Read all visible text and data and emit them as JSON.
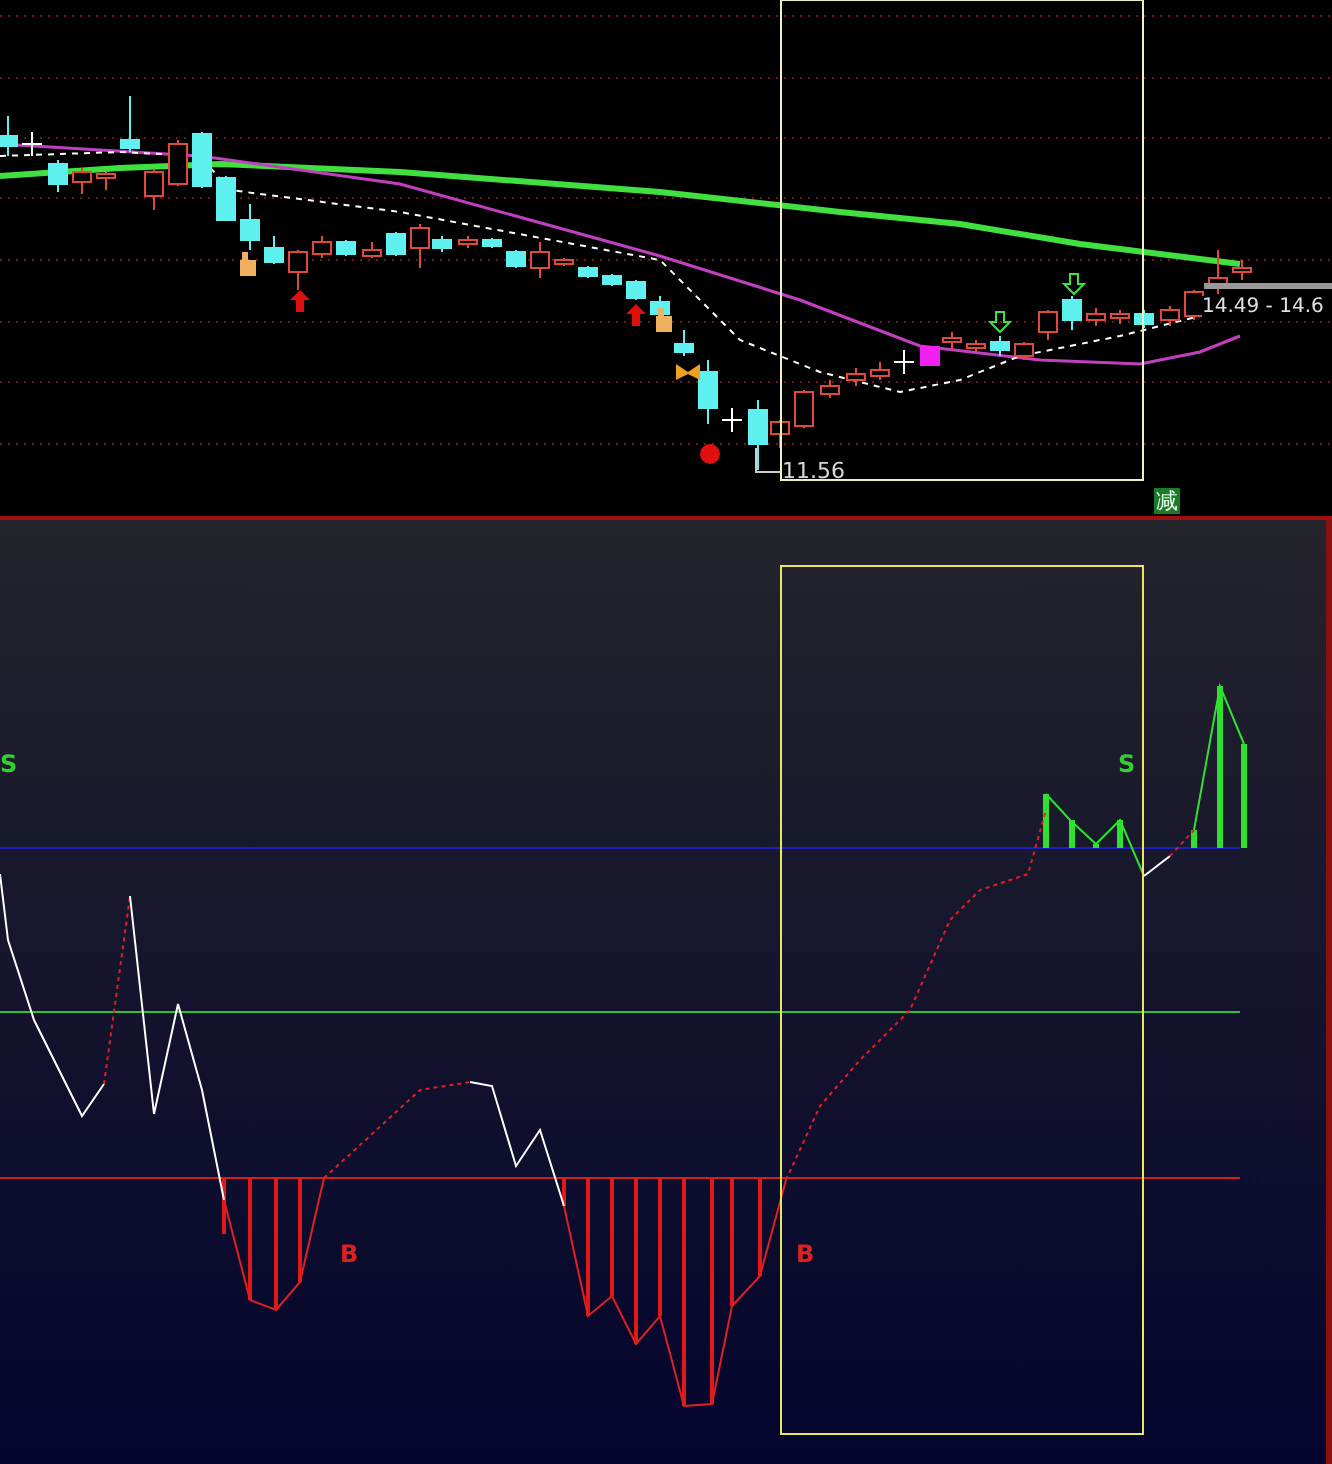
{
  "price_panel": {
    "low_label": "11.56",
    "price_range_label": "14.49 - 14.6",
    "signal_badge": "减"
  },
  "indicator_panel": {
    "markers": [
      {
        "kind": "sell",
        "label": "S"
      },
      {
        "kind": "sell",
        "label": "S"
      },
      {
        "kind": "buy",
        "label": "B"
      },
      {
        "kind": "buy",
        "label": "B"
      }
    ]
  }
}
